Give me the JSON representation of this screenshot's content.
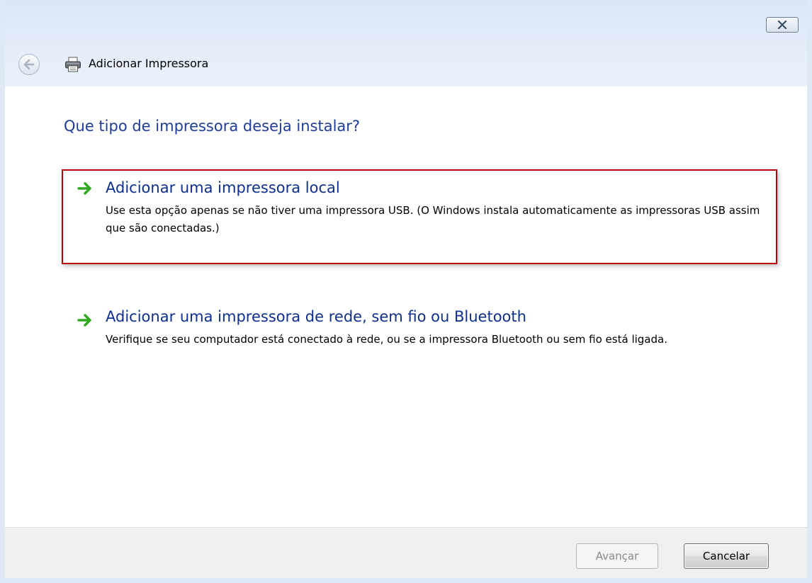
{
  "window": {
    "title": "Adicionar Impressora"
  },
  "main": {
    "heading": "Que tipo de impressora deseja instalar?",
    "options": [
      {
        "title": "Adicionar uma impressora local",
        "description": "Use esta opção apenas se não tiver uma impressora USB. (O Windows instala automaticamente as impressoras USB assim que são conectadas.)",
        "selected": true
      },
      {
        "title": "Adicionar uma impressora de rede, sem fio ou Bluetooth",
        "description": "Verifique se seu computador está conectado à rede, ou se a impressora Bluetooth ou sem fio está ligada.",
        "selected": false
      }
    ]
  },
  "footer": {
    "next_label": "Avançar",
    "cancel_label": "Cancelar"
  },
  "colors": {
    "heading": "#1e3c9a",
    "option_title": "#0f2f8f",
    "highlight_border": "#b8000a",
    "arrow": "#2fa81f"
  },
  "icons": {
    "close": "close-icon",
    "back": "back-arrow-icon",
    "printer": "printer-icon",
    "option_arrow": "green-arrow-icon"
  }
}
